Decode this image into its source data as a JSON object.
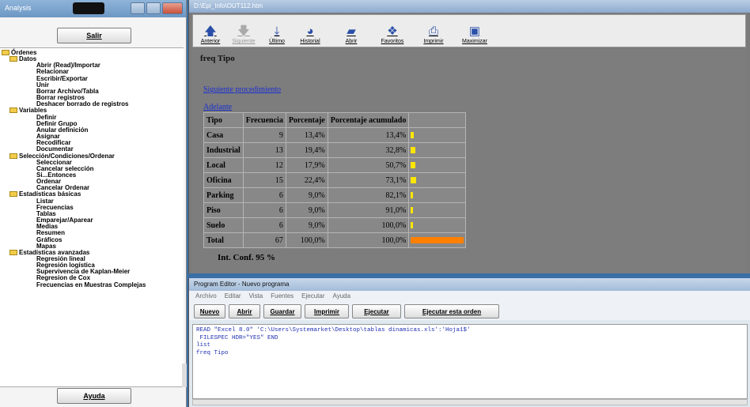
{
  "left_window": {
    "title": "Analysis",
    "exit_label": "Salir",
    "help_label": "Ayuda",
    "tree": [
      {
        "label": "Órdenes",
        "level": 0,
        "folder": true
      },
      {
        "label": "Datos",
        "level": 1,
        "folder": true
      },
      {
        "label": "Abrir (Read)/Importar",
        "level": 2
      },
      {
        "label": "Relacionar",
        "level": 2
      },
      {
        "label": "Escribir/Exportar",
        "level": 2
      },
      {
        "label": "Unir",
        "level": 2
      },
      {
        "label": "Borrar Archivo/Tabla",
        "level": 2
      },
      {
        "label": "Borrar registros",
        "level": 2
      },
      {
        "label": "Deshacer borrado de registros",
        "level": 2
      },
      {
        "label": "Variables",
        "level": 1,
        "folder": true
      },
      {
        "label": "Definir",
        "level": 2
      },
      {
        "label": "Definir Grupo",
        "level": 2
      },
      {
        "label": "Anular definición",
        "level": 2
      },
      {
        "label": "Asignar",
        "level": 2
      },
      {
        "label": "Recodificar",
        "level": 2
      },
      {
        "label": "Documentar",
        "level": 2
      },
      {
        "label": "Selección/Condiciones/Ordenar",
        "level": 1,
        "folder": true
      },
      {
        "label": "Seleccionar",
        "level": 2
      },
      {
        "label": "Cancelar selección",
        "level": 2
      },
      {
        "label": "Si...Entonces",
        "level": 2
      },
      {
        "label": "Ordenar",
        "level": 2
      },
      {
        "label": "Cancelar Ordenar",
        "level": 2
      },
      {
        "label": "Estadísticas básicas",
        "level": 1,
        "folder": true
      },
      {
        "label": "Listar",
        "level": 2
      },
      {
        "label": "Frecuencias",
        "level": 2
      },
      {
        "label": "Tablas",
        "level": 2
      },
      {
        "label": "Emparejar/Aparear",
        "level": 2
      },
      {
        "label": "Medias",
        "level": 2
      },
      {
        "label": "Resumen",
        "level": 2
      },
      {
        "label": "Gráficos",
        "level": 2
      },
      {
        "label": "Mapas",
        "level": 2
      },
      {
        "label": "Estadísticas avanzadas",
        "level": 1,
        "folder": true
      },
      {
        "label": "Regresión lineal",
        "level": 2
      },
      {
        "label": "Regresión logística",
        "level": 2
      },
      {
        "label": "Supervivencia de Kaplan-Meier",
        "level": 2
      },
      {
        "label": "Regresion de Cox",
        "level": 2
      },
      {
        "label": "Frecuencias en Muestras Complejas",
        "level": 2
      }
    ]
  },
  "browser": {
    "title": "D:\\Epi_Info\\OUT112.htm",
    "toolbar": [
      {
        "label": "Anterior",
        "icon": "up-arrow-icon",
        "glyph": "🡅",
        "disabled": false
      },
      {
        "label": "Siguiente",
        "icon": "down-arrow-icon",
        "glyph": "🡇",
        "disabled": true
      },
      {
        "label": "Último",
        "icon": "bottom-arrow-icon",
        "glyph": "⤓",
        "disabled": false
      },
      {
        "label": "Historial",
        "icon": "history-icon",
        "glyph": "◕",
        "disabled": false
      },
      {
        "label": "Abrir",
        "icon": "open-folder-icon",
        "glyph": "▰",
        "disabled": false
      },
      {
        "label": "Favoritos",
        "icon": "favorites-icon",
        "glyph": "❖",
        "disabled": false
      },
      {
        "label": "Imprimir",
        "icon": "printer-icon",
        "glyph": "⎙",
        "disabled": false
      },
      {
        "label": "Maximizar",
        "icon": "maximize-icon",
        "glyph": "▣",
        "disabled": false
      }
    ],
    "heading": "freq Tipo",
    "next_link": "Siguiente procedimiento",
    "forward_link": "Adelante",
    "table": {
      "headers": [
        "Tipo",
        "Frecuencia",
        "Porcentaje",
        "Porcentaje acumulado"
      ],
      "rows": [
        {
          "tipo": "Casa",
          "frecuencia": "9",
          "porcentaje": "13,4%",
          "acumulado": "13,4%",
          "bar_fraction": 0.134
        },
        {
          "tipo": "Industrial",
          "frecuencia": "13",
          "porcentaje": "19,4%",
          "acumulado": "32,8%",
          "bar_fraction": 0.194
        },
        {
          "tipo": "Local",
          "frecuencia": "12",
          "porcentaje": "17,9%",
          "acumulado": "50,7%",
          "bar_fraction": 0.179
        },
        {
          "tipo": "Oficina",
          "frecuencia": "15",
          "porcentaje": "22,4%",
          "acumulado": "73,1%",
          "bar_fraction": 0.224
        },
        {
          "tipo": "Parking",
          "frecuencia": "6",
          "porcentaje": "9,0%",
          "acumulado": "82,1%",
          "bar_fraction": 0.09
        },
        {
          "tipo": "Piso",
          "frecuencia": "6",
          "porcentaje": "9,0%",
          "acumulado": "91,0%",
          "bar_fraction": 0.09
        },
        {
          "tipo": "Suelo",
          "frecuencia": "6",
          "porcentaje": "9,0%",
          "acumulado": "100,0%",
          "bar_fraction": 0.09
        }
      ],
      "total": {
        "tipo": "Total",
        "frecuencia": "67",
        "porcentaje": "100,0%",
        "acumulado": "100,0%",
        "bar_fraction": 1.0
      }
    },
    "ci_label": "Int. Conf. 95 %",
    "colors": {
      "bar": "#ffe600",
      "total_bar": "#ff8000",
      "link": "#1a2fd0"
    }
  },
  "editor": {
    "title": "Program Editor - Nuevo programa",
    "menu": [
      "Archivo",
      "Editar",
      "Vista",
      "Fuentes",
      "Ejecutar",
      "Ayuda"
    ],
    "buttons": [
      "Nuevo",
      "Abrir",
      "Guardar",
      "Imprimir",
      "Ejecutar",
      "Ejecutar esta orden"
    ],
    "code": "READ \"Excel 8.0\" 'C:\\Users\\Systemarket\\Desktop\\tablas dinamicas.xls':'Hoja1$'\n FILESPEC HDR=\"YES\" END\nlist\nfreq Tipo"
  }
}
